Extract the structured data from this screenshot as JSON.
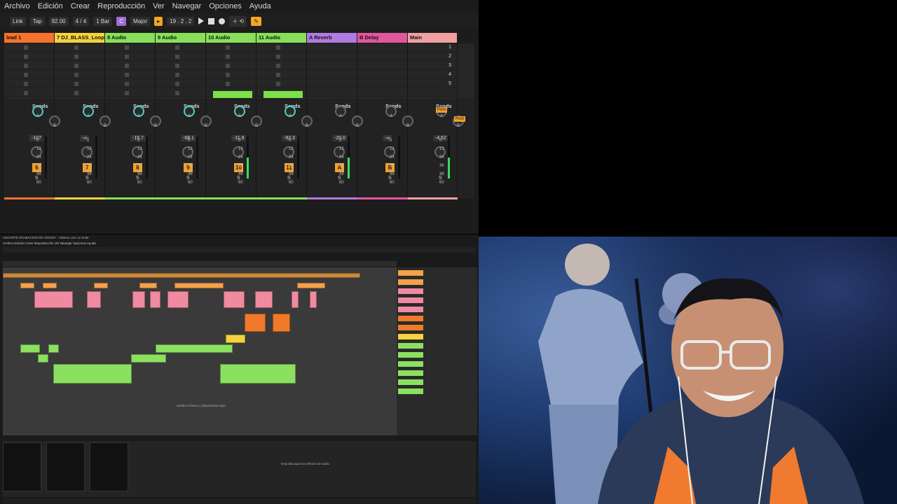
{
  "menu": [
    "Archivo",
    "Edición",
    "Crear",
    "Reproducción",
    "Ver",
    "Navegar",
    "Opciones",
    "Ayuda"
  ],
  "transport": {
    "link": "Link",
    "tap": "Tap",
    "tempo": "92.00",
    "signature": "4 / 4",
    "quantize": "1 Bar",
    "key": "C",
    "scale": "Major",
    "position": "19 . 2 . 2"
  },
  "tracks": [
    {
      "name": "lead 1",
      "color": "#f5732d",
      "num": "6",
      "vol": "-107"
    },
    {
      "name": "7 DJ_BLASS_Loop",
      "color": "#f4d33c",
      "num": "7",
      "vol": "-∞"
    },
    {
      "name": "8 Audio",
      "color": "#88e05a",
      "num": "8",
      "vol": "-15.7"
    },
    {
      "name": "9 Audio",
      "color": "#88e05a",
      "num": "9",
      "vol": "-68.1"
    },
    {
      "name": "10 Audio",
      "color": "#88e05a",
      "num": "10",
      "vol": "-11.9"
    },
    {
      "name": "11 Audio",
      "color": "#88e05a",
      "num": "11",
      "vol": "-92.3"
    },
    {
      "name": "A Reverb",
      "color": "#b07be0",
      "num": "A",
      "vol": "-20.0"
    },
    {
      "name": "B Delay",
      "color": "#e0579c",
      "num": "B",
      "vol": "-∞"
    },
    {
      "name": "Main",
      "color": "#f0a0a0",
      "num": "",
      "vol": "-4.52"
    }
  ],
  "scenes": [
    "1",
    "2",
    "3",
    "4",
    "5"
  ],
  "labels": {
    "sends": "Sends",
    "post": "Post",
    "solo": "Solo",
    "a": "A",
    "b": "B",
    "s": "S"
  },
  "meter_scale": [
    "0",
    "12",
    "24",
    "36",
    "48",
    "60"
  ],
  "mini": {
    "title": "ANGARTE GRABACION DE VOCES* - Ableton Live 12 Suite",
    "menu": "Archivo  Edición  Crear  Reproducción  Ver  Navegar  Opciones  Ayuda",
    "drop_hint": "Suelta Archivos y Dispositivos aquí",
    "drop_fx": "Deposita aquí los efectos de audio"
  }
}
